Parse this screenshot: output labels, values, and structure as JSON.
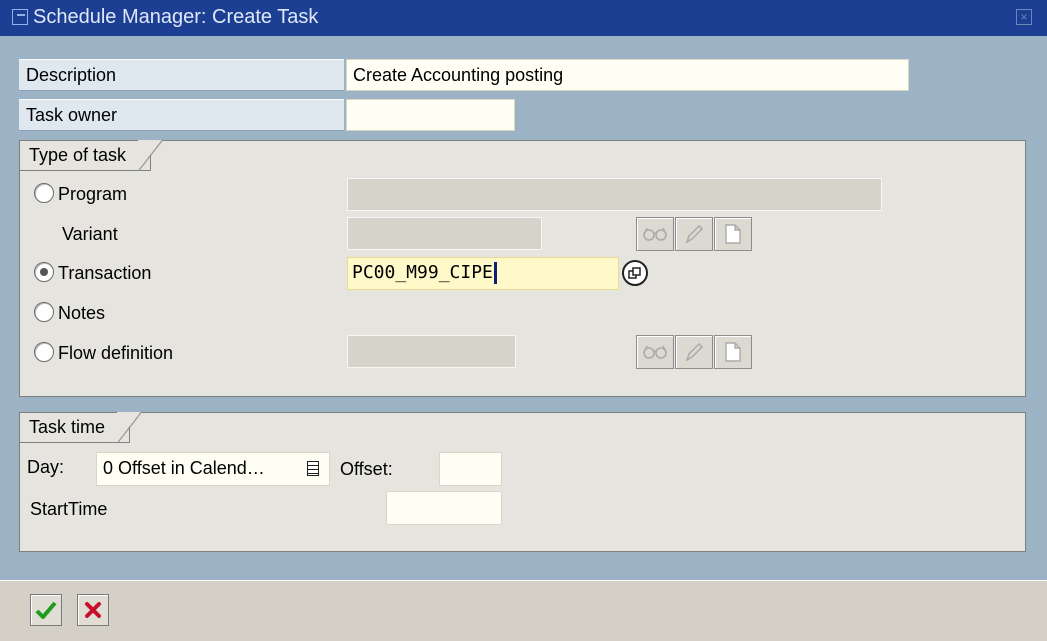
{
  "window": {
    "title": "Schedule Manager: Create Task"
  },
  "fields": {
    "description": {
      "label": "Description",
      "value": "Create Accounting posting"
    },
    "task_owner": {
      "label": "Task owner",
      "value": ""
    }
  },
  "type_of_task": {
    "tab_label": "Type of task",
    "program_label": "Program",
    "variant_label": "Variant",
    "transaction_label": "Transaction",
    "transaction_value": "PC00_M99_CIPE",
    "notes_label": "Notes",
    "flow_label": "Flow definition",
    "selected": "Transaction"
  },
  "task_time": {
    "tab_label": "Task time",
    "day_label": "Day:",
    "day_value": "0 Offset in Calend…",
    "offset_label": "Offset:",
    "offset_value": "",
    "start_label": "StartTime",
    "start_value": ""
  },
  "icons": {
    "display": "glasses-icon",
    "change": "pencil-icon",
    "create": "document-icon",
    "matchcode": "matchcode-icon",
    "dropdown": "list-icon",
    "confirm": "check-icon",
    "cancel": "cancel-icon",
    "close": "close-icon"
  },
  "colors": {
    "titlebar": "#1c3f93",
    "background": "#9cb2c5",
    "active_field": "#fff8c8",
    "confirm": "#1d9d1d",
    "cancel": "#c8102e"
  }
}
